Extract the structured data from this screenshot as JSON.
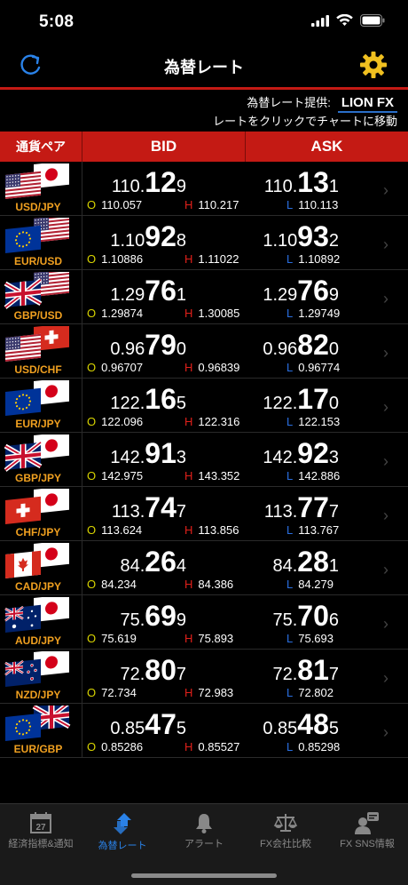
{
  "status": {
    "time": "5:08"
  },
  "nav": {
    "title": "為替レート"
  },
  "provider": {
    "label": "為替レート提供:",
    "name": "LION FX",
    "hint": "レートをクリックでチャートに移動"
  },
  "header": {
    "pair": "通貨ペア",
    "bid": "BID",
    "ask": "ASK"
  },
  "rates": [
    {
      "pair": "USD/JPY",
      "flags": [
        "us",
        "jp"
      ],
      "bid": [
        "110.",
        "12",
        "9"
      ],
      "ask": [
        "110.",
        "13",
        "1"
      ],
      "open": "110.057",
      "high": "110.217",
      "low": "110.113"
    },
    {
      "pair": "EUR/USD",
      "flags": [
        "eu",
        "us"
      ],
      "bid": [
        "1.10",
        "92",
        "8"
      ],
      "ask": [
        "1.10",
        "93",
        "2"
      ],
      "open": "1.10886",
      "high": "1.11022",
      "low": "1.10892"
    },
    {
      "pair": "GBP/USD",
      "flags": [
        "gb",
        "us"
      ],
      "bid": [
        "1.29",
        "76",
        "1"
      ],
      "ask": [
        "1.29",
        "76",
        "9"
      ],
      "open": "1.29874",
      "high": "1.30085",
      "low": "1.29749"
    },
    {
      "pair": "USD/CHF",
      "flags": [
        "us",
        "ch"
      ],
      "bid": [
        "0.96",
        "79",
        "0"
      ],
      "ask": [
        "0.96",
        "82",
        "0"
      ],
      "open": "0.96707",
      "high": "0.96839",
      "low": "0.96774"
    },
    {
      "pair": "EUR/JPY",
      "flags": [
        "eu",
        "jp"
      ],
      "bid": [
        "122.",
        "16",
        "5"
      ],
      "ask": [
        "122.",
        "17",
        "0"
      ],
      "open": "122.096",
      "high": "122.316",
      "low": "122.153"
    },
    {
      "pair": "GBP/JPY",
      "flags": [
        "gb",
        "jp"
      ],
      "bid": [
        "142.",
        "91",
        "3"
      ],
      "ask": [
        "142.",
        "92",
        "3"
      ],
      "open": "142.975",
      "high": "143.352",
      "low": "142.886"
    },
    {
      "pair": "CHF/JPY",
      "flags": [
        "ch",
        "jp"
      ],
      "bid": [
        "113.",
        "74",
        "7"
      ],
      "ask": [
        "113.",
        "77",
        "7"
      ],
      "open": "113.624",
      "high": "113.856",
      "low": "113.767"
    },
    {
      "pair": "CAD/JPY",
      "flags": [
        "ca",
        "jp"
      ],
      "bid": [
        "84.",
        "26",
        "4"
      ],
      "ask": [
        "84.",
        "28",
        "1"
      ],
      "open": "84.234",
      "high": "84.386",
      "low": "84.279"
    },
    {
      "pair": "AUD/JPY",
      "flags": [
        "au",
        "jp"
      ],
      "bid": [
        "75.",
        "69",
        "9"
      ],
      "ask": [
        "75.",
        "70",
        "6"
      ],
      "open": "75.619",
      "high": "75.893",
      "low": "75.693"
    },
    {
      "pair": "NZD/JPY",
      "flags": [
        "nz",
        "jp"
      ],
      "bid": [
        "72.",
        "80",
        "7"
      ],
      "ask": [
        "72.",
        "81",
        "7"
      ],
      "open": "72.734",
      "high": "72.983",
      "low": "72.802"
    },
    {
      "pair": "EUR/GBP",
      "flags": [
        "eu",
        "gb"
      ],
      "bid": [
        "0.85",
        "47",
        "5"
      ],
      "ask": [
        "0.85",
        "48",
        "5"
      ],
      "open": "0.85286",
      "high": "0.85527",
      "low": "0.85298"
    }
  ],
  "markers": {
    "open": "O",
    "high": "H",
    "low": "L"
  },
  "tabs": [
    {
      "label": "経済指標&通知",
      "icon": "calendar-icon",
      "calendar_day": "27",
      "active": false
    },
    {
      "label": "為替レート",
      "icon": "exchange-arrows-icon",
      "active": true
    },
    {
      "label": "アラート",
      "icon": "bell-icon",
      "active": false
    },
    {
      "label": "FX会社比較",
      "icon": "scale-icon",
      "active": false
    },
    {
      "label": "FX SNS情報",
      "icon": "user-chat-icon",
      "active": false
    }
  ],
  "colors": {
    "accent_red": "#c41a14",
    "active_blue": "#2a82e8",
    "pair_orange": "#f0a020",
    "open_yellow": "#d8d400",
    "high_red": "#e0201a",
    "low_blue": "#2a6fe0"
  }
}
